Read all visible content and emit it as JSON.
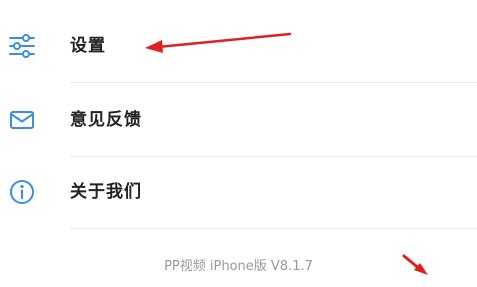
{
  "menu": {
    "items": [
      {
        "label": "设置",
        "icon": "settings-sliders-icon"
      },
      {
        "label": "意见反馈",
        "icon": "mail-icon"
      },
      {
        "label": "关于我们",
        "icon": "info-icon"
      }
    ]
  },
  "footer": {
    "version_text": "PP视频 iPhone版 V8.1.7"
  },
  "colors": {
    "icon_blue": "#3a8ee6",
    "annotation_red": "#e02020",
    "text_dark": "#222222",
    "text_gray": "#999999",
    "divider": "#e8e8e8"
  }
}
